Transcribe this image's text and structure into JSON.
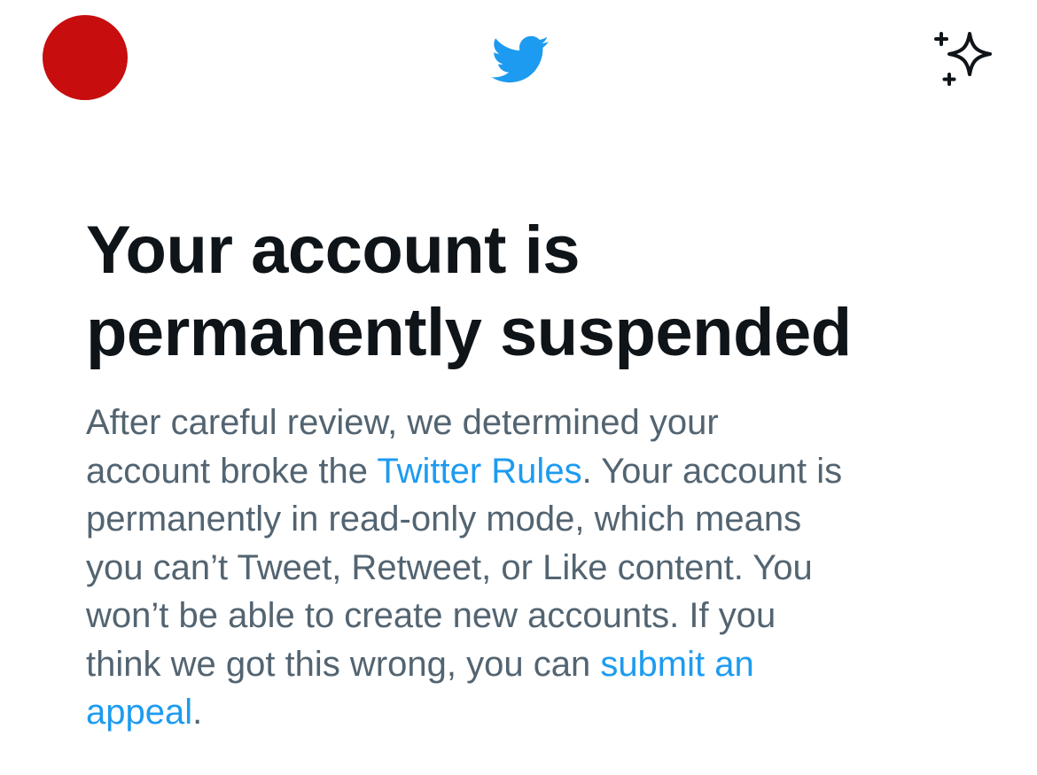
{
  "header": {
    "avatar_color": "#c70d0d",
    "logo_icon": "twitter-bird-icon",
    "logo_color": "#1d9bf0",
    "sparkle_icon": "sparkle-icon"
  },
  "title_line1": "Your account is",
  "title_line2": "permanently suspended",
  "body": {
    "line1": "After careful review, we determined your",
    "line2_before": "account broke the ",
    "rules_link": "Twitter Rules",
    "line2_after": ". Your account is",
    "line3": "permanently in read-only mode, which means",
    "line4": "you can’t Tweet, Retweet, or Like content. You",
    "line5": "won’t be able to create new accounts. If you",
    "line6_before": "think we got this wrong, you can ",
    "appeal_link_part1": "submit an",
    "appeal_link_part2": "appeal",
    "end_period": "."
  }
}
